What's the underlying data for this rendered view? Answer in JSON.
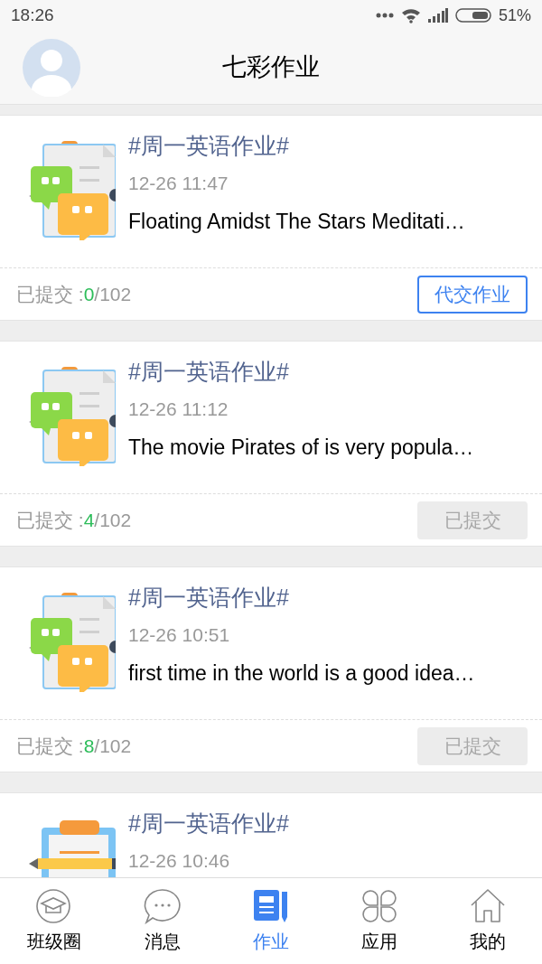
{
  "status_bar": {
    "time": "18:26",
    "battery": "51%"
  },
  "header": {
    "title": "七彩作业"
  },
  "cards": [
    {
      "kind": "quotes",
      "title": "#周一英语作业#",
      "time": "12-26 11:47",
      "text": "Floating Amidst The Stars Meditati…",
      "submitted_label": "已提交 :",
      "submitted": "0",
      "total": "/102",
      "action": {
        "label": "代交作业",
        "disabled": false
      }
    },
    {
      "kind": "quotes",
      "title": "#周一英语作业#",
      "time": "12-26 11:12",
      "text": "The movie Pirates of  is very popula…",
      "submitted_label": "已提交 :",
      "submitted": "4",
      "total": "/102",
      "action": {
        "label": "已提交",
        "disabled": true
      }
    },
    {
      "kind": "quotes",
      "title": "#周一英语作业#",
      "time": "12-26 10:51",
      "text": "first time in the world is a good idea…",
      "submitted_label": "已提交 :",
      "submitted": "8",
      "total": "/102",
      "action": {
        "label": "已提交",
        "disabled": true
      }
    },
    {
      "kind": "clipboard",
      "title": "#周一英语作业#",
      "time": "12-26 10:46"
    }
  ],
  "tabs": [
    {
      "kind": "cap",
      "label": "班级圈",
      "selected": false
    },
    {
      "kind": "chat",
      "label": "消息",
      "selected": false
    },
    {
      "kind": "book",
      "label": "作业",
      "selected": true
    },
    {
      "kind": "clover",
      "label": "应用",
      "selected": false
    },
    {
      "kind": "house",
      "label": "我的",
      "selected": false
    }
  ]
}
